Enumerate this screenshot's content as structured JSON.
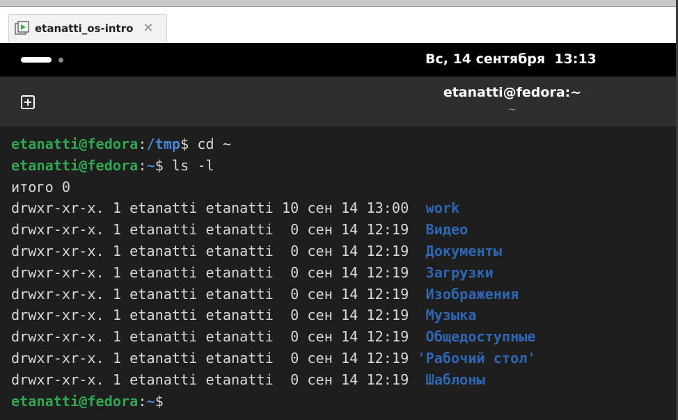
{
  "tab": {
    "title": "etanatti_os-intro",
    "close": "✕"
  },
  "topbar": {
    "clock": "Вс, 14 сентября  13:13"
  },
  "headerbar": {
    "title": "etanatti@fedora:~",
    "subtitle": "~"
  },
  "terminal": {
    "lines": [
      {
        "type": "prompt",
        "user": "etanatti@fedora",
        "path": "/tmp",
        "command": " cd ~"
      },
      {
        "type": "prompt",
        "user": "etanatti@fedora",
        "path": "~",
        "command": " ls -l"
      },
      {
        "type": "text",
        "text": "итого 0"
      },
      {
        "type": "entry",
        "meta": "drwxr-xr-x. 1 etanatti etanatti 10 сен 14 13:00 ",
        "name": " work"
      },
      {
        "type": "entry",
        "meta": "drwxr-xr-x. 1 etanatti etanatti  0 сен 14 12:19 ",
        "name": " Видео"
      },
      {
        "type": "entry",
        "meta": "drwxr-xr-x. 1 etanatti etanatti  0 сен 14 12:19 ",
        "name": " Документы"
      },
      {
        "type": "entry",
        "meta": "drwxr-xr-x. 1 etanatti etanatti  0 сен 14 12:19 ",
        "name": " Загрузки"
      },
      {
        "type": "entry",
        "meta": "drwxr-xr-x. 1 etanatti etanatti  0 сен 14 12:19 ",
        "name": " Изображения"
      },
      {
        "type": "entry",
        "meta": "drwxr-xr-x. 1 etanatti etanatti  0 сен 14 12:19 ",
        "name": " Музыка"
      },
      {
        "type": "entry",
        "meta": "drwxr-xr-x. 1 etanatti etanatti  0 сен 14 12:19 ",
        "name": " Общедоступные"
      },
      {
        "type": "entry",
        "meta": "drwxr-xr-x. 1 etanatti etanatti  0 сен 14 12:19 ",
        "name": "'Рабочий стол'"
      },
      {
        "type": "entry",
        "meta": "drwxr-xr-x. 1 etanatti etanatti  0 сен 14 12:19 ",
        "name": " Шаблоны"
      },
      {
        "type": "prompt",
        "user": "etanatti@fedora",
        "path": "~",
        "command": ""
      }
    ]
  },
  "colors": {
    "prompt_user": "#2fa652",
    "prompt_path": "#4a86d6",
    "directory": "#2f66b3",
    "text": "#d8d8d8",
    "background": "#1e1e1e"
  }
}
